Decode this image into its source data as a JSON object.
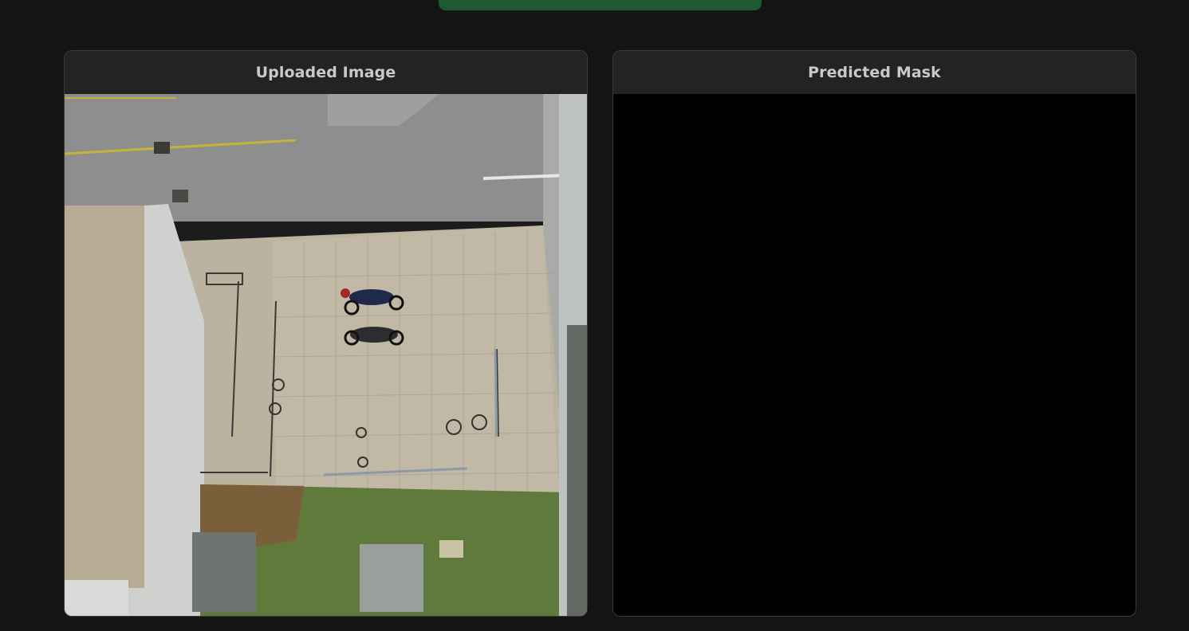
{
  "colors": {
    "background": "#141414",
    "accent_button": "#1d5a33",
    "card_header": "#232323",
    "mask": "#000000"
  },
  "panels": {
    "uploaded": {
      "title": "Uploaded Image"
    },
    "predicted": {
      "title": "Predicted Mask"
    }
  }
}
